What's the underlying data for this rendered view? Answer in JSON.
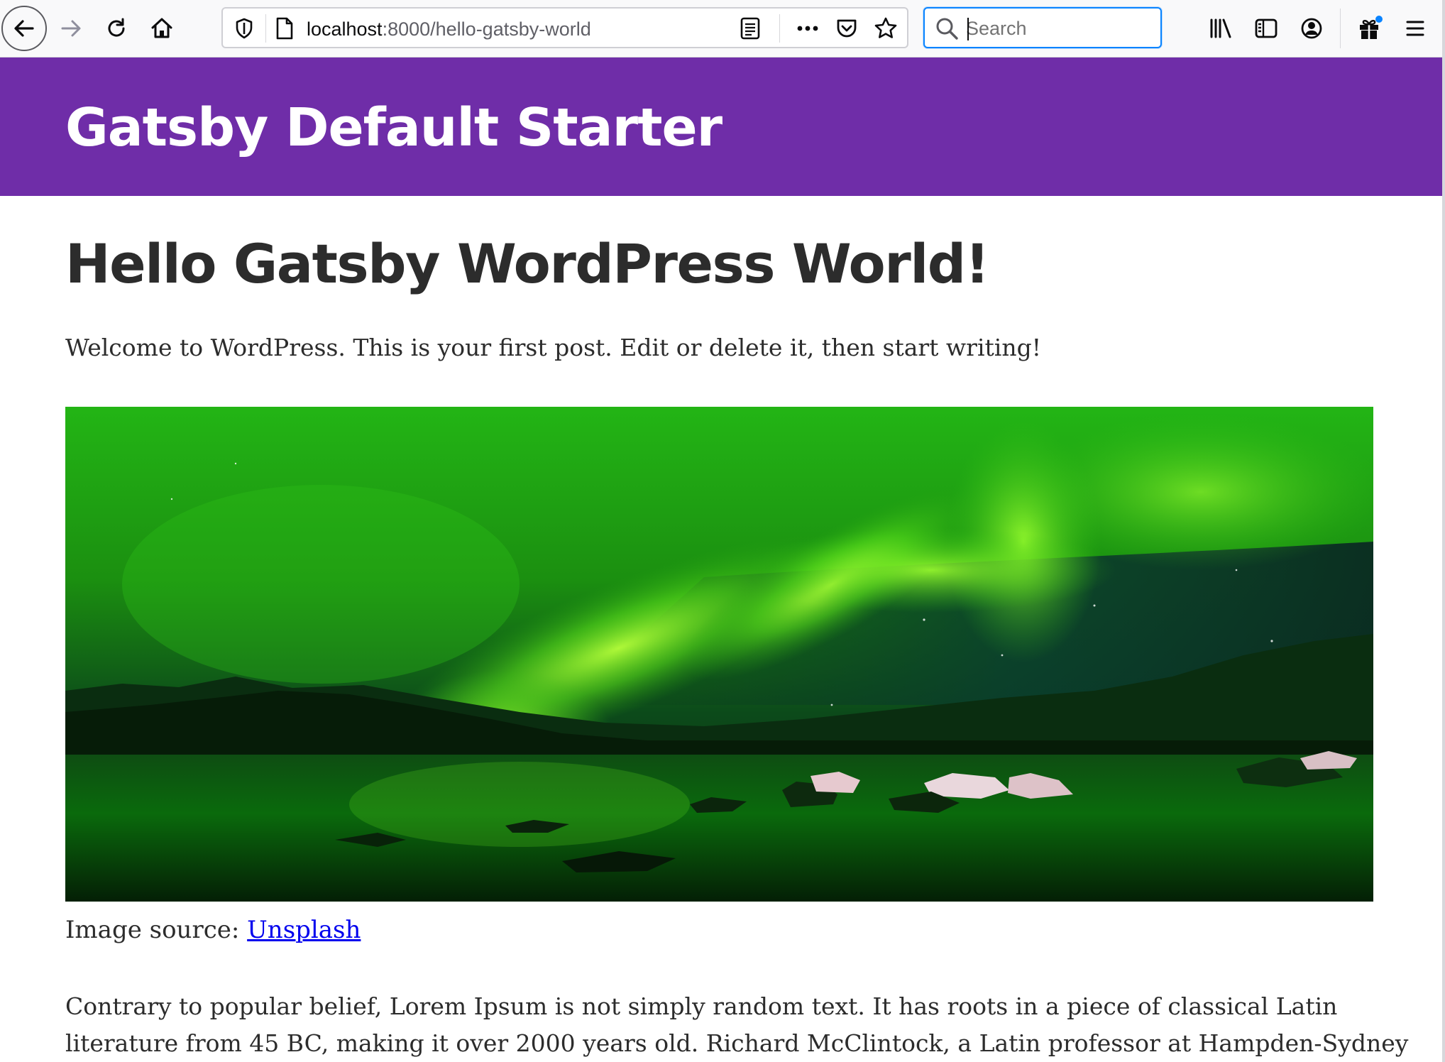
{
  "browser": {
    "url_host": "localhost",
    "url_path": ":8000/hello-gatsby-world",
    "search_placeholder": "Search"
  },
  "site": {
    "title": "Gatsby Default Starter",
    "header_color": "#6f2da8"
  },
  "post": {
    "title": "Hello Gatsby WordPress World!",
    "intro": "Welcome to WordPress. This is your first post. Edit or delete it, then start writing!",
    "caption_prefix": "Image source: ",
    "caption_link": "Unsplash",
    "body_lines": [
      "Contrary to popular belief, Lorem Ipsum is not simply random text. It has roots in a piece of classical Latin",
      "literature from 45 BC, making it over 2000 years old. Richard McClintock, a Latin professor at Hampden-Sydney"
    ]
  },
  "icons": [
    "back-arrow-icon",
    "forward-arrow-icon",
    "reload-icon",
    "home-icon",
    "tracking-shield-icon",
    "page-icon",
    "reader-view-icon",
    "page-actions-icon",
    "pocket-icon",
    "bookmark-star-icon",
    "search-icon",
    "library-icon",
    "sidebar-icon",
    "account-icon",
    "whats-new-gift-icon",
    "menu-icon"
  ]
}
